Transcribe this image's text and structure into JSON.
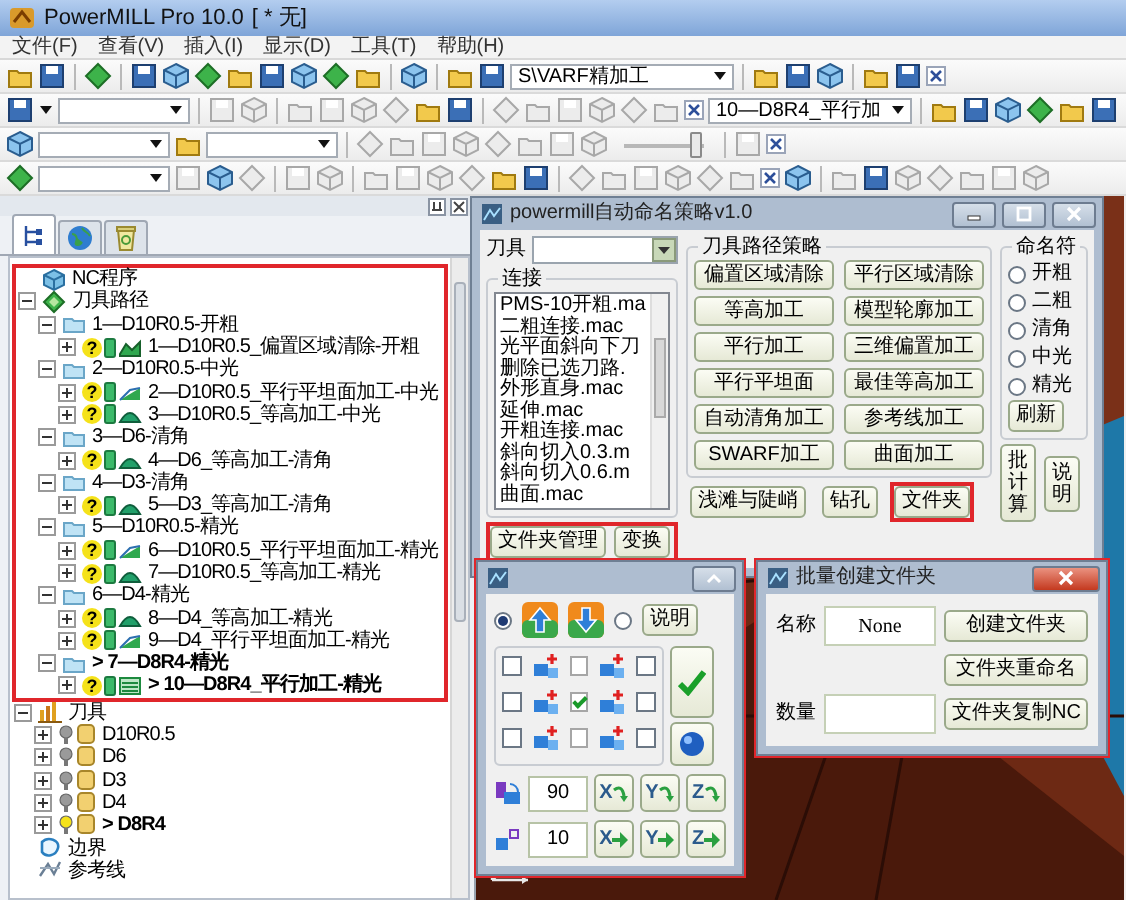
{
  "window": {
    "title": "PowerMILL Pro 10.0",
    "document": "[ * 无]"
  },
  "menu": [
    "文件(F)",
    "查看(V)",
    "插入(I)",
    "显示(D)",
    "工具(T)",
    "帮助(H)"
  ],
  "toolbars": [
    {
      "items": [
        {
          "kind": "button",
          "disabled": false
        },
        {
          "kind": "button",
          "disabled": false
        },
        {
          "kind": "sep"
        },
        {
          "kind": "button",
          "disabled": false
        },
        {
          "kind": "sep"
        },
        {
          "kind": "button",
          "disabled": false
        },
        {
          "kind": "button",
          "disabled": false
        },
        {
          "kind": "button",
          "disabled": false
        },
        {
          "kind": "button",
          "disabled": false
        },
        {
          "kind": "button",
          "disabled": false
        },
        {
          "kind": "button",
          "disabled": false
        },
        {
          "kind": "button",
          "disabled": false
        },
        {
          "kind": "button",
          "disabled": false
        },
        {
          "kind": "sep"
        },
        {
          "kind": "button",
          "disabled": false
        },
        {
          "kind": "sep"
        },
        {
          "kind": "button",
          "disabled": false
        },
        {
          "kind": "button",
          "disabled": false
        },
        {
          "kind": "combo",
          "value": "S\\VARF精加工"
        },
        {
          "kind": "sep"
        },
        {
          "kind": "button",
          "disabled": false
        },
        {
          "kind": "button",
          "disabled": false
        },
        {
          "kind": "button",
          "disabled": false
        },
        {
          "kind": "sep"
        },
        {
          "kind": "button",
          "disabled": false
        },
        {
          "kind": "button",
          "disabled": false
        },
        {
          "kind": "close"
        }
      ]
    },
    {
      "items": [
        {
          "kind": "button",
          "disabled": false
        },
        {
          "kind": "caret"
        },
        {
          "kind": "combo"
        },
        {
          "kind": "sep"
        },
        {
          "kind": "button",
          "disabled": true
        },
        {
          "kind": "button",
          "disabled": true
        },
        {
          "kind": "sep"
        },
        {
          "kind": "button",
          "disabled": true
        },
        {
          "kind": "button",
          "disabled": true
        },
        {
          "kind": "button",
          "disabled": true
        },
        {
          "kind": "button",
          "disabled": true
        },
        {
          "kind": "button",
          "disabled": false
        },
        {
          "kind": "button",
          "disabled": false
        },
        {
          "kind": "sep"
        },
        {
          "kind": "button",
          "disabled": true
        },
        {
          "kind": "button",
          "disabled": true
        },
        {
          "kind": "button",
          "disabled": true
        },
        {
          "kind": "button",
          "disabled": true
        },
        {
          "kind": "button",
          "disabled": true
        },
        {
          "kind": "button",
          "disabled": true
        },
        {
          "kind": "close"
        },
        {
          "kind": "combo",
          "value": "10—D8R4_平行加"
        },
        {
          "kind": "sep"
        },
        {
          "kind": "button",
          "disabled": false
        },
        {
          "kind": "button",
          "disabled": false
        },
        {
          "kind": "button",
          "disabled": false
        },
        {
          "kind": "button",
          "disabled": false
        },
        {
          "kind": "button",
          "disabled": false
        },
        {
          "kind": "button",
          "disabled": false
        }
      ]
    },
    {
      "items": [
        {
          "kind": "button",
          "disabled": false
        },
        {
          "kind": "combo"
        },
        {
          "kind": "button",
          "disabled": false
        },
        {
          "kind": "combo"
        },
        {
          "kind": "sep"
        },
        {
          "kind": "button",
          "disabled": true
        },
        {
          "kind": "button",
          "disabled": true
        },
        {
          "kind": "button",
          "disabled": true
        },
        {
          "kind": "button",
          "disabled": true
        },
        {
          "kind": "button",
          "disabled": true
        },
        {
          "kind": "button",
          "disabled": true
        },
        {
          "kind": "button",
          "disabled": true
        },
        {
          "kind": "button",
          "disabled": true
        },
        {
          "kind": "slider",
          "level": 0.9
        },
        {
          "kind": "sep"
        },
        {
          "kind": "button",
          "disabled": true
        },
        {
          "kind": "close"
        }
      ]
    },
    {
      "items": [
        {
          "kind": "button",
          "disabled": false
        },
        {
          "kind": "combo"
        },
        {
          "kind": "button",
          "disabled": true
        },
        {
          "kind": "button",
          "disabled": false
        },
        {
          "kind": "button",
          "disabled": true
        },
        {
          "kind": "sep"
        },
        {
          "kind": "button",
          "disabled": true
        },
        {
          "kind": "button",
          "disabled": true
        },
        {
          "kind": "sep"
        },
        {
          "kind": "button",
          "disabled": true
        },
        {
          "kind": "button",
          "disabled": true
        },
        {
          "kind": "button",
          "disabled": true
        },
        {
          "kind": "button",
          "disabled": true
        },
        {
          "kind": "button",
          "disabled": false
        },
        {
          "kind": "button",
          "disabled": false
        },
        {
          "kind": "sep"
        },
        {
          "kind": "button",
          "disabled": true
        },
        {
          "kind": "button",
          "disabled": true
        },
        {
          "kind": "button",
          "disabled": true
        },
        {
          "kind": "button",
          "disabled": true
        },
        {
          "kind": "button",
          "disabled": true
        },
        {
          "kind": "button",
          "disabled": true
        },
        {
          "kind": "close"
        },
        {
          "kind": "button",
          "disabled": false
        },
        {
          "kind": "sep"
        },
        {
          "kind": "button",
          "disabled": true
        },
        {
          "kind": "button",
          "disabled": false
        },
        {
          "kind": "button",
          "disabled": true
        },
        {
          "kind": "button",
          "disabled": true
        },
        {
          "kind": "button",
          "disabled": true
        },
        {
          "kind": "button",
          "disabled": true
        },
        {
          "kind": "button",
          "disabled": true
        }
      ]
    }
  ],
  "explorer": {
    "tabs": [
      {
        "kind": "tree",
        "selected": true
      },
      {
        "kind": "globe",
        "selected": false
      },
      {
        "kind": "bin",
        "selected": false
      }
    ],
    "tree": [
      {
        "kind": "nc",
        "label": "NC程序",
        "highlighted": true
      },
      {
        "kind": "toolpaths",
        "label": "刀具路径",
        "expanded": true,
        "highlighted": true,
        "children": [
          {
            "kind": "folder",
            "label": "1—D10R0.5-开粗",
            "expanded": true,
            "active": false,
            "children": [
              {
                "kind": "area",
                "label": "1—D10R0.5_偏置区域清除-开粗",
                "status": "?",
                "expanded": false,
                "active": false
              }
            ]
          },
          {
            "kind": "folder",
            "label": "2—D10R0.5-中光",
            "expanded": true,
            "active": false,
            "children": [
              {
                "kind": "flat",
                "label": "2—D10R0.5_平行平坦面加工-中光",
                "status": "?",
                "expanded": false,
                "active": false
              },
              {
                "kind": "constz",
                "label": "3—D10R0.5_等高加工-中光",
                "status": "?",
                "expanded": false,
                "active": false
              }
            ]
          },
          {
            "kind": "folder",
            "label": "3—D6-清角",
            "expanded": true,
            "active": false,
            "children": [
              {
                "kind": "constz",
                "label": "4—D6_等高加工-清角",
                "status": "?",
                "expanded": false,
                "active": false
              }
            ]
          },
          {
            "kind": "folder",
            "label": "4—D3-清角",
            "expanded": true,
            "active": false,
            "children": [
              {
                "kind": "constz",
                "label": "5—D3_等高加工-清角",
                "status": "?",
                "expanded": false,
                "active": false
              }
            ]
          },
          {
            "kind": "folder",
            "label": "5—D10R0.5-精光",
            "expanded": true,
            "active": false,
            "children": [
              {
                "kind": "flat",
                "label": "6—D10R0.5_平行平坦面加工-精光",
                "status": "?",
                "expanded": false,
                "active": false
              },
              {
                "kind": "constz",
                "label": "7—D10R0.5_等高加工-精光",
                "status": "?",
                "expanded": false,
                "active": false
              }
            ]
          },
          {
            "kind": "folder",
            "label": "6—D4-精光",
            "expanded": true,
            "active": false,
            "children": [
              {
                "kind": "constz",
                "label": "8—D4_等高加工-精光",
                "status": "?",
                "expanded": false,
                "active": false
              },
              {
                "kind": "flat",
                "label": "9—D4_平行平坦面加工-精光",
                "status": "?",
                "expanded": false,
                "active": false
              }
            ]
          },
          {
            "kind": "folder",
            "label": "> 7—D8R4-精光",
            "expanded": true,
            "active": true,
            "children": [
              {
                "kind": "raster",
                "label": "> 10—D8R4_平行加工-精光",
                "status": "?",
                "expanded": false,
                "active": true
              }
            ]
          }
        ]
      },
      {
        "kind": "tools",
        "label": "刀具",
        "expanded": true,
        "highlighted": false,
        "children": [
          {
            "kind": "tool",
            "label": "D10R0.5",
            "expanded": false,
            "active": false
          },
          {
            "kind": "tool",
            "label": "D6",
            "expanded": false,
            "active": false
          },
          {
            "kind": "tool",
            "label": "D3",
            "expanded": false,
            "active": false
          },
          {
            "kind": "tool",
            "label": "D4",
            "expanded": false,
            "active": false
          },
          {
            "kind": "tool",
            "label": "> D8R4",
            "expanded": false,
            "active": true
          }
        ]
      },
      {
        "kind": "boundaries",
        "label": "边界",
        "highlighted": false
      },
      {
        "kind": "patterns",
        "label": "参考线",
        "highlighted": false
      }
    ]
  },
  "strategy_window": {
    "title": "powermill自动命名策略v1.0",
    "tool_label": "刀具",
    "link_title": "连接",
    "macros": [
      "PMS-10开粗.ma",
      "二粗连接.mac",
      "光平面斜向下刀",
      "删除已选刀路.",
      "外形直身.mac",
      "延伸.mac",
      "开粗连接.mac",
      "斜向切入0.3.m",
      "斜向切入0.6.m",
      "曲面.mac"
    ],
    "link_buttons": {
      "highlighted": true,
      "buttons": [
        "文件夹管理",
        "变换"
      ]
    },
    "strategy_title": "刀具路径策略",
    "strategies": [
      "偏置区域清除",
      "平行区域清除",
      "等高加工",
      "模型轮廓加工",
      "平行加工",
      "三维偏置加工",
      "平行平坦面",
      "最佳等高加工",
      "自动清角加工",
      "参考线加工",
      "SWARF加工",
      "曲面加工"
    ],
    "extra_buttons": [
      {
        "label": "浅滩与陡峭",
        "highlighted": false
      },
      {
        "label": "钻孔",
        "highlighted": false
      },
      {
        "label": "文件夹",
        "highlighted": true
      }
    ],
    "naming_title": "命名符",
    "naming": [
      {
        "label": "开粗",
        "selected": false
      },
      {
        "label": "二粗",
        "selected": false
      },
      {
        "label": "清角",
        "selected": false
      },
      {
        "label": "中光",
        "selected": false
      },
      {
        "label": "精光",
        "selected": false
      }
    ],
    "refresh": "刷新",
    "side_buttons": [
      "批计算",
      "说明"
    ]
  },
  "transform_window": {
    "highlighted": true,
    "directions": [
      {
        "kind": "up",
        "selected": true
      },
      {
        "kind": "down",
        "selected": false
      }
    ],
    "help": "说明",
    "grid": [
      {
        "left": false,
        "middle": false,
        "right": false
      },
      {
        "left": false,
        "middle": true,
        "right": false
      },
      {
        "left": false,
        "middle": false,
        "right": false
      }
    ],
    "angle": "90",
    "step": "10",
    "rotate_buttons": [
      "X",
      "Y",
      "Z"
    ],
    "move_buttons": [
      "X",
      "Y",
      "Z"
    ]
  },
  "batch_window": {
    "title": "批量创建文件夹",
    "highlighted": true,
    "name_label": "名称",
    "name_value": "None",
    "count_label": "数量",
    "buttons": [
      "创建文件夹",
      "文件夹重命名",
      "文件夹复制NC"
    ]
  }
}
